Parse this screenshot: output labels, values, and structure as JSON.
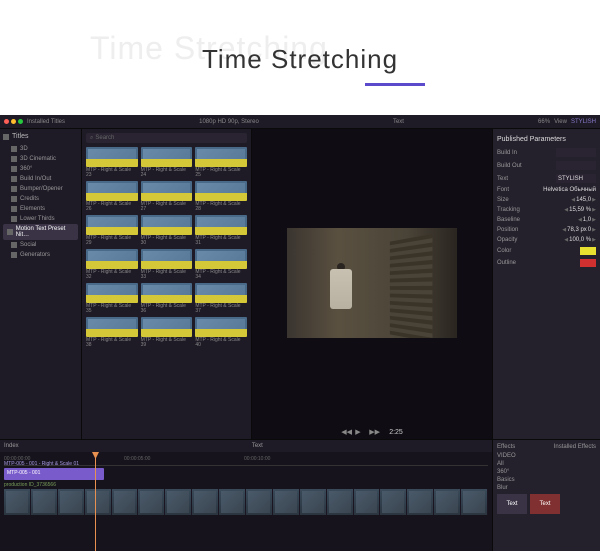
{
  "hero": {
    "ghost": "Time Stretching",
    "title": "Time Stretching"
  },
  "topbar": {
    "installed": "Installed Titles",
    "format": "1080p HD 90p, Stereo",
    "clip": "Text",
    "zoom": "66%",
    "view": "View",
    "project": "STYLISH"
  },
  "sidebar": {
    "head": "Titles",
    "items": [
      {
        "label": "3D"
      },
      {
        "label": "3D Cinematic"
      },
      {
        "label": "360°"
      },
      {
        "label": "Build In/Out"
      },
      {
        "label": "Bumper/Opener"
      },
      {
        "label": "Credits"
      },
      {
        "label": "Elements"
      },
      {
        "label": "Lower Thirds"
      },
      {
        "label": "Motion Text Preset Nit…",
        "sel": true
      },
      {
        "label": "Social"
      },
      {
        "label": "Generators"
      }
    ]
  },
  "search": {
    "placeholder": "Search"
  },
  "thumbs": [
    {
      "label": "MTP - Right & Scale 23"
    },
    {
      "label": "MTP - Right & Scale 24"
    },
    {
      "label": "MTP - Right & Scale 25"
    },
    {
      "label": "MTP - Right & Scale 26"
    },
    {
      "label": "MTP - Right & Scale 27"
    },
    {
      "label": "MTP - Right & Scale 28"
    },
    {
      "label": "MTP - Right & Scale 29"
    },
    {
      "label": "MTP - Right & Scale 30"
    },
    {
      "label": "MTP - Right & Scale 31"
    },
    {
      "label": "MTP - Right & Scale 32"
    },
    {
      "label": "MTP - Right & Scale 33"
    },
    {
      "label": "MTP - Right & Scale 34"
    },
    {
      "label": "MTP - Right & Scale 35"
    },
    {
      "label": "MTP - Right & Scale 36"
    },
    {
      "label": "MTP - Right & Scale 37"
    },
    {
      "label": "MTP - Right & Scale 38"
    },
    {
      "label": "MTP - Right & Scale 39"
    },
    {
      "label": "MTP - Right & Scale 40"
    }
  ],
  "viewer": {
    "timecode": "2:25"
  },
  "inspector": {
    "head": "Published Parameters",
    "rows": [
      {
        "k": "Build In",
        "v": ""
      },
      {
        "k": "Build Out",
        "v": ""
      },
      {
        "k": "Text",
        "v": "STYLISH"
      }
    ],
    "font": {
      "k": "Font",
      "family": "Helvetica",
      "style": "Обычный"
    },
    "params": [
      {
        "k": "Size",
        "v": "145,0"
      },
      {
        "k": "Tracking",
        "v": "15,59 %"
      },
      {
        "k": "Baseline",
        "v": "1,0"
      },
      {
        "k": "Position",
        "v": "78,3 px",
        "v2": "0"
      },
      {
        "k": "Opacity",
        "v": "100,0 %"
      }
    ],
    "color": {
      "k": "Color"
    },
    "outline": {
      "k": "Outline"
    }
  },
  "timeline": {
    "index": "Index",
    "name": "Text",
    "ticks": [
      "00:00:00:00",
      "00:00:05:00",
      "00:00:10:00"
    ],
    "title_clip": {
      "path": "MTP-005 - 001 - Right & Scale 01",
      "name": "MTP-005 - 001"
    },
    "video_clip": "production ID_3736566"
  },
  "effects": {
    "head": "Effects",
    "installed": "Installed Effects",
    "cats": [
      "VIDEO",
      "All",
      "360°",
      "Basics",
      "Blur"
    ],
    "thumbs": [
      "Text",
      "Text"
    ]
  }
}
